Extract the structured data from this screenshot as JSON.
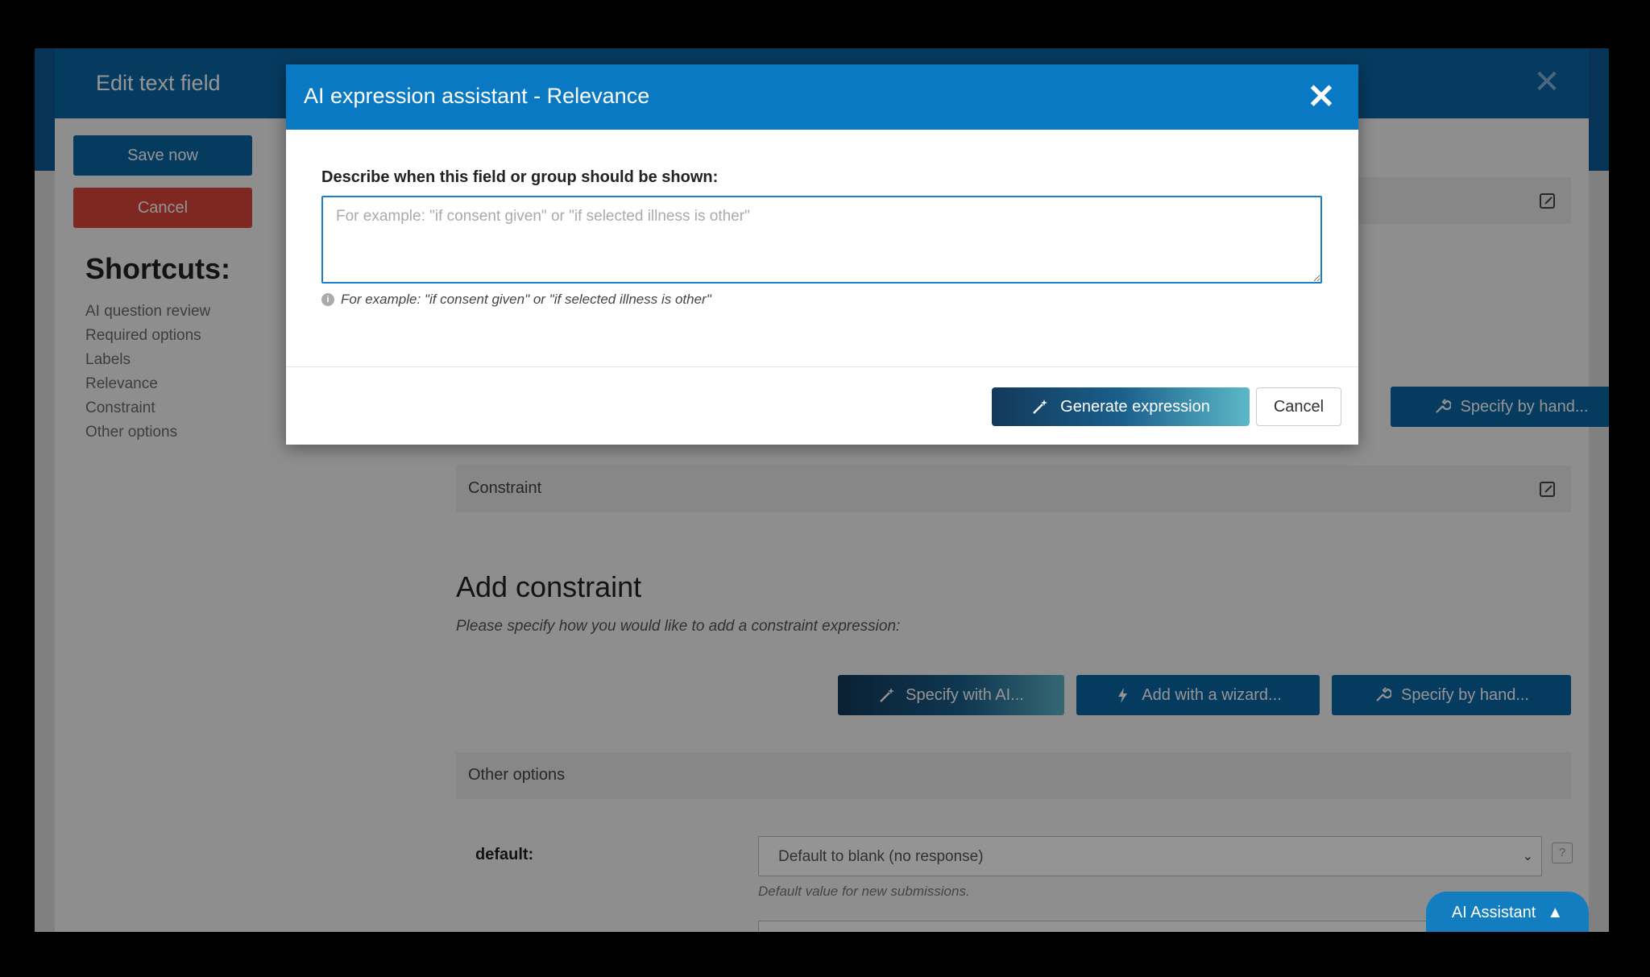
{
  "panel": {
    "title": "Edit text field",
    "save_label": "Save now",
    "cancel_label": "Cancel",
    "shortcuts_title": "Shortcuts:",
    "shortcuts": [
      "AI question review",
      "Required options",
      "Labels",
      "Relevance",
      "Constraint",
      "Other options"
    ]
  },
  "sections": {
    "constraint_label": "Constraint",
    "add_constraint_title": "Add constraint",
    "add_constraint_text": "Please specify how you would like to add a constraint expression:",
    "specify_ai_label": "Specify with AI...",
    "wizard_label": "Add with a wizard...",
    "specify_hand_label": "Specify by hand...",
    "other_options_label": "Other options",
    "default_label": "default:",
    "default_value": "Default to blank (no response)",
    "default_hint": "Default value for new submissions."
  },
  "modal": {
    "title": "AI expression assistant - Relevance",
    "describe_label": "Describe when this field or group should be shown:",
    "placeholder": "For example: \"if consent given\" or \"if selected illness is other\"",
    "hint": "For example: \"if consent given\" or \"if selected illness is other\"",
    "generate_label": "Generate expression",
    "cancel_label": "Cancel"
  },
  "ai_assistant": {
    "label": "AI Assistant",
    "arrow": "▲"
  },
  "colors": {
    "header_blue": "#0979c3",
    "primary_blue": "#0b66a6",
    "danger_red": "#d9453a"
  }
}
